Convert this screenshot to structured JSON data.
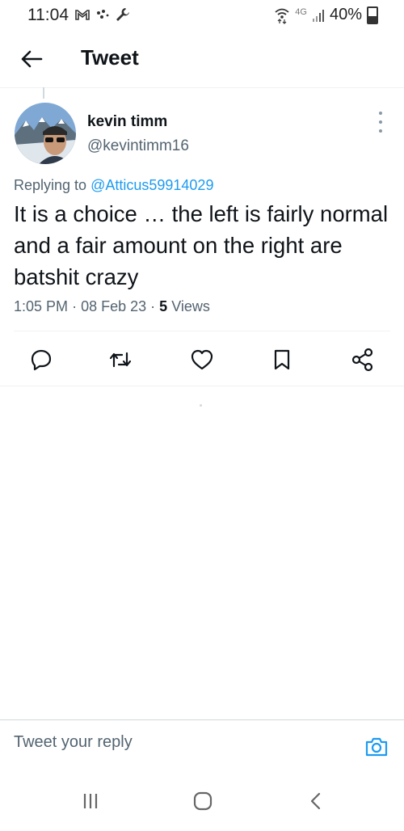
{
  "status_bar": {
    "time": "11:04",
    "network": "4G",
    "battery": "40%",
    "battery_level": 0.4,
    "icons": [
      "gmail-icon",
      "dots-icon",
      "wrench-icon",
      "wifi-icon",
      "signal-icon",
      "battery-icon"
    ]
  },
  "header": {
    "title": "Tweet",
    "back_icon": "arrow-left-icon"
  },
  "tweet": {
    "author_name": "kevin timm",
    "author_handle": "@kevintimm16",
    "replying_prefix": "Replying to",
    "replying_to": "@Atticus59914029",
    "text": "It is a choice … the left is fairly normal and a fair amount on the right are batshit crazy",
    "time": "1:05 PM",
    "date": "08 Feb 23",
    "views_count": "5",
    "views_label": "Views",
    "separator": "·"
  },
  "actions": [
    {
      "name": "reply-icon"
    },
    {
      "name": "retweet-icon"
    },
    {
      "name": "like-icon"
    },
    {
      "name": "bookmark-icon"
    },
    {
      "name": "share-icon"
    }
  ],
  "reply_bar": {
    "placeholder": "Tweet your reply",
    "camera_icon": "camera-icon"
  },
  "nav_bar": {
    "buttons": [
      "recents-icon",
      "home-icon",
      "back-icon"
    ]
  },
  "colors": {
    "accent": "#1d9bf0",
    "text": "#0f1419",
    "secondary": "#536471",
    "divider": "#eff3f4"
  }
}
